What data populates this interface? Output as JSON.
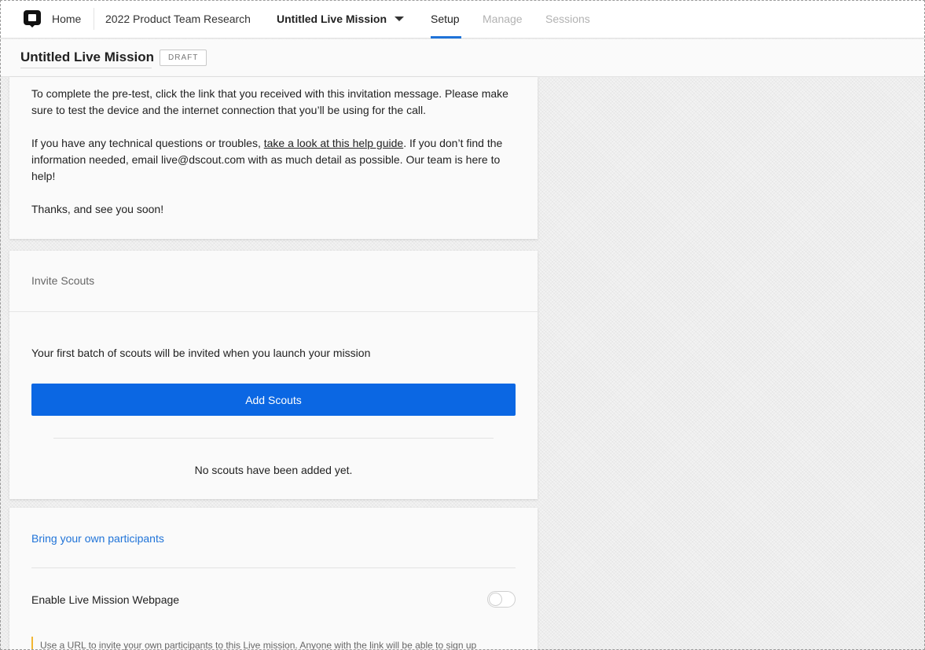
{
  "nav": {
    "home": "Home",
    "project": "2022 Product Team Research",
    "mission": "Untitled Live Mission",
    "tabs": [
      {
        "label": "Setup",
        "active": true
      },
      {
        "label": "Manage",
        "active": false
      },
      {
        "label": "Sessions",
        "active": false
      }
    ]
  },
  "header": {
    "title": "Untitled Live Mission",
    "badge": "DRAFT"
  },
  "message": {
    "p1": "To complete the pre-test, click the link that you received with this invitation message. Please make sure to test the device and the internet connection that you’ll be using for the call.",
    "p2_before": "If you have any technical questions or troubles, ",
    "p2_link": "take a look at this help guide",
    "p2_after": ". If you don’t find the information needed, email live@dscout.com with as much detail as possible. Our team is here to help!",
    "p3": "Thanks, and see you soon!"
  },
  "invite": {
    "title": "Invite Scouts",
    "batch_text": "Your first batch of scouts will be invited when you launch your mission",
    "add_button": "Add Scouts",
    "empty_text": "No scouts have been added yet."
  },
  "byo": {
    "link": "Bring your own participants",
    "enable_label": "Enable Live Mission Webpage",
    "toggle_on": false,
    "hint": "Use a URL to invite your own participants to this Live mission. Anyone with the link will be able to sign up"
  },
  "colors": {
    "accent": "#1f73d8",
    "button": "#0b67e3",
    "hint_bar": "#f2b632"
  }
}
